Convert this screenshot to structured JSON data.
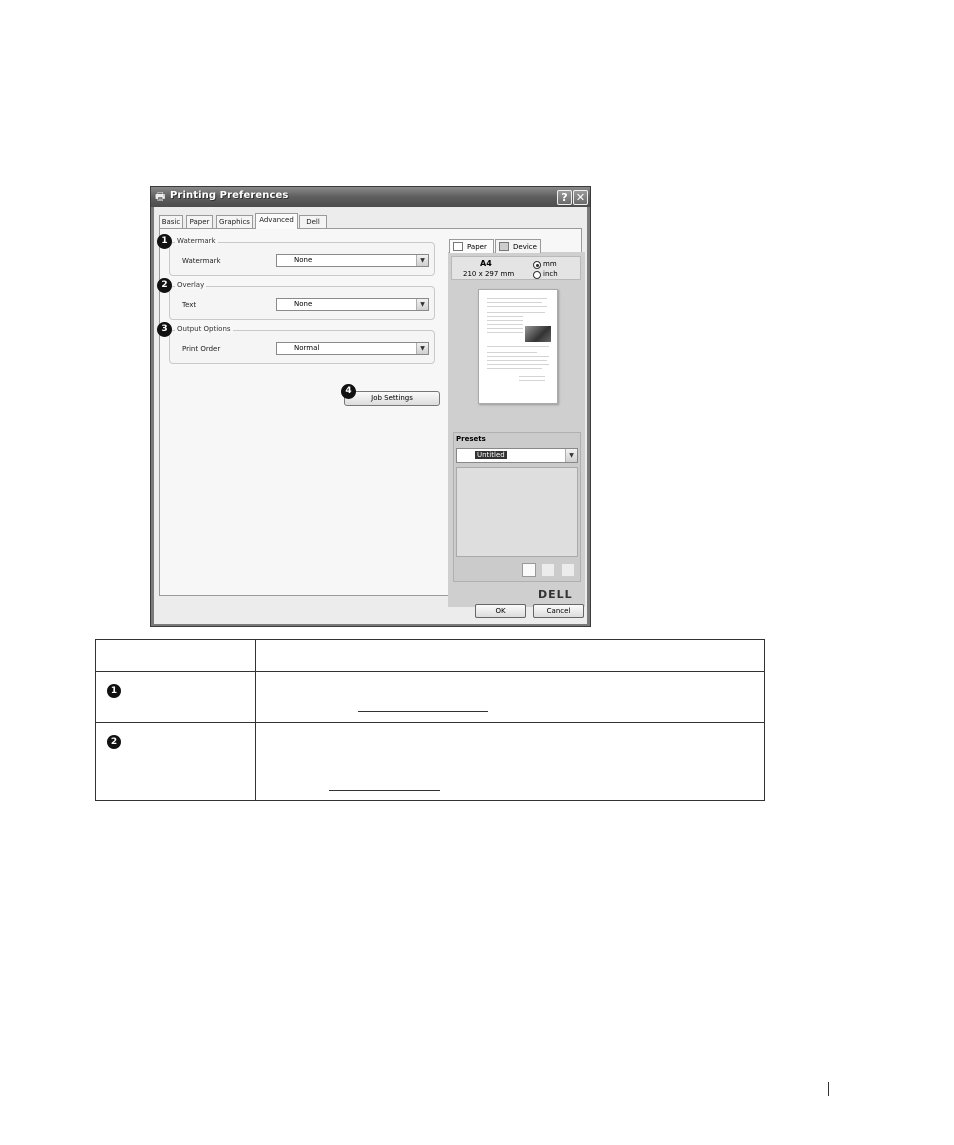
{
  "window": {
    "title": "Printing Preferences",
    "help_button": "?",
    "close_button": "✕"
  },
  "tabs": [
    {
      "label": "Basic"
    },
    {
      "label": "Paper"
    },
    {
      "label": "Graphics"
    },
    {
      "label": "Advanced",
      "active": true
    },
    {
      "label": "Dell"
    }
  ],
  "groups": {
    "watermark": {
      "callout": "1",
      "legend": "Watermark",
      "field_label": "Watermark",
      "value": "None"
    },
    "overlay": {
      "callout": "2",
      "legend": "Overlay",
      "field_label": "Text",
      "value": "None"
    },
    "output": {
      "callout": "3",
      "legend": "Output Options",
      "field_label": "Print Order",
      "value": "Normal"
    }
  },
  "job_settings": {
    "callout": "4",
    "label": "Job Settings"
  },
  "right_panel": {
    "tabs": [
      {
        "label": "Paper",
        "active": true
      },
      {
        "label": "Device"
      }
    ],
    "paper_size": "A4",
    "paper_dimensions": "210 x 297 mm",
    "unit_options": [
      {
        "label": "mm",
        "checked": true
      },
      {
        "label": "inch",
        "checked": false
      }
    ],
    "presets_label": "Presets",
    "presets_value": "Untitled",
    "logo": "DELL"
  },
  "buttons": {
    "ok": "OK",
    "cancel": "Cancel"
  },
  "table": {
    "rows": [
      {
        "callout": "1"
      },
      {
        "callout": "2"
      }
    ]
  },
  "icons": {
    "dropdown": "chevron-down-icon",
    "title": "printer-icon"
  }
}
